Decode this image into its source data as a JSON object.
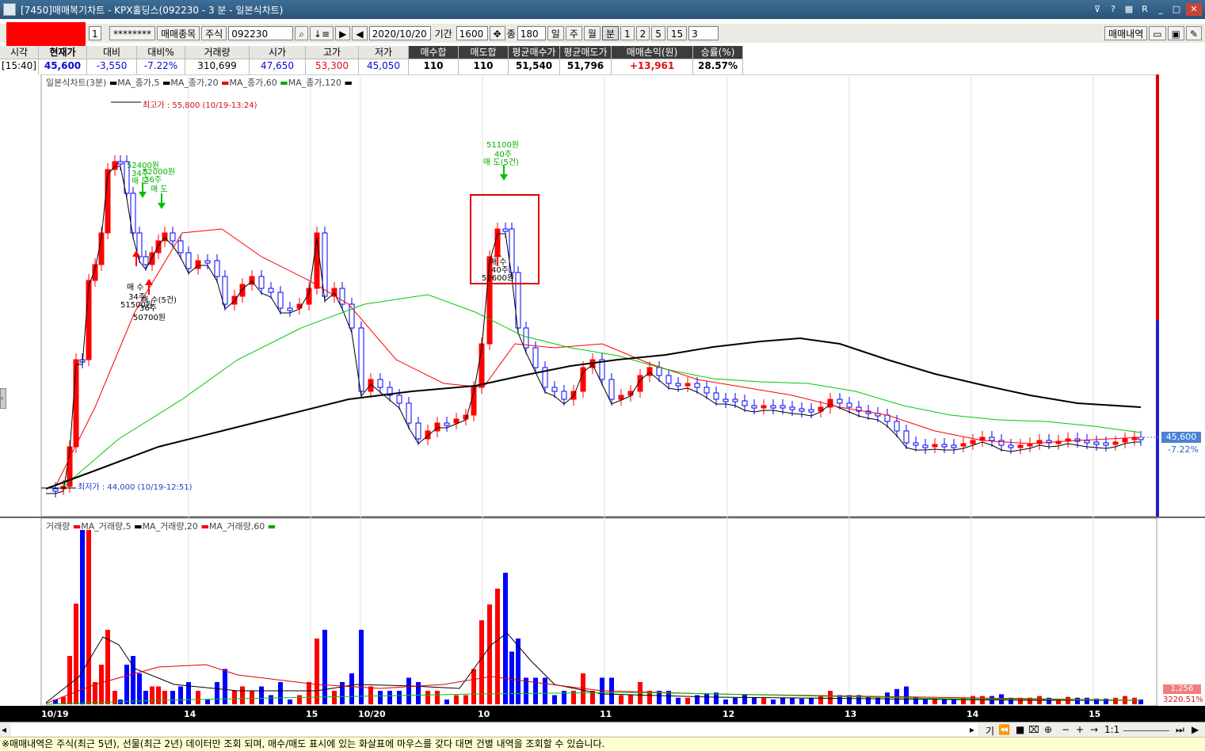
{
  "window": {
    "title": "[7450]매매복기차트 - KPX홀딩스(092230 - 3 분 - 일본식차트)",
    "buttons": [
      "?",
      "?",
      "R",
      "_",
      "□",
      "✕"
    ]
  },
  "toolbar": {
    "account_suffix": "1",
    "password": "********",
    "trade_items_button": "매매종목",
    "market_button": "주식",
    "code": "092230",
    "date": "2020/10/20",
    "period_label": "기간",
    "period_value": "1600",
    "jung_label": "종",
    "count_value": "180",
    "day_btn": "일",
    "week_btn": "주",
    "month_btn": "월",
    "minute_btn": "분",
    "interval_1": "1",
    "interval_2": "2",
    "interval_5": "5",
    "interval_15": "15",
    "interval_value": "3",
    "trade_history_button": "매매내역"
  },
  "quote": {
    "headers": [
      "시각",
      "현재가",
      "대비",
      "대비%",
      "거래량",
      "시가",
      "고가",
      "저가",
      "매수합",
      "매도합",
      "평균매수가",
      "평균매도가",
      "매매손익(원)",
      "승률(%)"
    ],
    "values": [
      "[15:40]",
      "45,600",
      "-3,550",
      "-7.22%",
      "310,699",
      "47,650",
      "53,300",
      "45,050",
      "110",
      "110",
      "51,540",
      "51,796",
      "+13,961",
      "28.57%"
    ]
  },
  "price_panel": {
    "legend_title": "일본식차트(3분)",
    "legend_items": [
      "MA_종가,5",
      "MA_종가,20",
      "MA_종가,60",
      "MA_종가,120"
    ],
    "high_annotation": "최고가 : 55,800 (10/19-13:24)",
    "low_annotation": "최저가 : 44,000 (10/19-12:51)",
    "current_price_tag": "45,600",
    "current_pct_tag": "-7.22%"
  },
  "volume_panel": {
    "legend_title": "거래량",
    "legend_items": [
      "MA_거래량,5",
      "MA_거래량,20",
      "MA_거래량,60"
    ],
    "volume_tag": "1,256",
    "volume_pct_tag": "3220.51%"
  },
  "trade_marks": {
    "sell1_price": "52400원",
    "sell1_qty": "34주",
    "sell1_label": "매 도",
    "sell2_price": "52000원",
    "sell2_qty": "36주",
    "sell2_label": "매 도",
    "buy1_label": "매 수",
    "buy1_qty": "34주",
    "buy1_price": "51500원",
    "buy2_label": "매 수(5건)",
    "buy2_qty": "36주",
    "buy2_price": "50700원",
    "sell3_price": "51100원",
    "sell3_qty": "40주",
    "sell3_label": "매 도(5건)",
    "buy3_label": "매 수",
    "buy3_qty": "40주",
    "buy3_price": "52600원"
  },
  "x_axis": {
    "labels": [
      "10/19",
      "14",
      "15",
      "10/20",
      "10",
      "11",
      "12",
      "13",
      "14",
      "15"
    ]
  },
  "scroll_controls": {
    "ratio": "1:1",
    "items": [
      "기",
      "⏪",
      "■",
      "⌧",
      "⊕",
      "−",
      "+",
      "→"
    ]
  },
  "status_bar": {
    "text": "※매매내역은 주식(최근 5년), 선물(최근 2년) 데이터만 조회 되며, 매수/매도 표시에 있는 화살표에 마우스를 갖다 대면 건별 내역을 조회할 수 있습니다."
  },
  "colors": {
    "up_candle": "#ff0000",
    "down_candle": "#0000ff",
    "ma5": "#000000",
    "ma20": "#ff0000",
    "ma60": "#00c800",
    "ma120": "#000000",
    "buy_arrow": "#ff0000",
    "sell_arrow": "#00c000"
  }
}
